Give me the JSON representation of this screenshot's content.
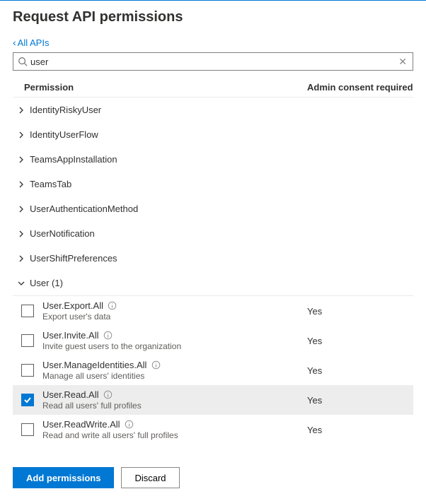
{
  "title": "Request API permissions",
  "back_link_label": "All APIs",
  "search": {
    "value": "user"
  },
  "columns": {
    "permission": "Permission",
    "consent": "Admin consent required"
  },
  "groups": [
    {
      "label": "IdentityRiskyUser",
      "expanded": false
    },
    {
      "label": "IdentityUserFlow",
      "expanded": false
    },
    {
      "label": "TeamsAppInstallation",
      "expanded": false
    },
    {
      "label": "TeamsTab",
      "expanded": false
    },
    {
      "label": "UserAuthenticationMethod",
      "expanded": false
    },
    {
      "label": "UserNotification",
      "expanded": false
    },
    {
      "label": "UserShiftPreferences",
      "expanded": false
    }
  ],
  "expanded_group": {
    "label": "User (1)",
    "permissions": [
      {
        "name": "User.Export.All",
        "desc": "Export user's data",
        "consent": "Yes",
        "checked": false
      },
      {
        "name": "User.Invite.All",
        "desc": "Invite guest users to the organization",
        "consent": "Yes",
        "checked": false
      },
      {
        "name": "User.ManageIdentities.All",
        "desc": "Manage all users' identities",
        "consent": "Yes",
        "checked": false
      },
      {
        "name": "User.Read.All",
        "desc": "Read all users' full profiles",
        "consent": "Yes",
        "checked": true
      },
      {
        "name": "User.ReadWrite.All",
        "desc": "Read and write all users' full profiles",
        "consent": "Yes",
        "checked": false
      }
    ]
  },
  "footer": {
    "add_label": "Add permissions",
    "discard_label": "Discard"
  }
}
